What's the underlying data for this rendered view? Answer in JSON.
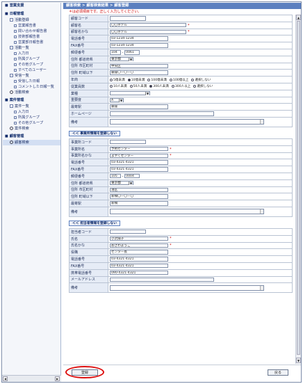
{
  "sidebar": {
    "sections": [
      {
        "title": "営業支援",
        "type": "sec"
      },
      {
        "title": "日報管理",
        "type": "sec"
      },
      {
        "title": "活動登録",
        "type": "sub"
      },
      {
        "title": "営業報告書",
        "type": "it"
      },
      {
        "title": "問い合わせ報告書",
        "type": "it"
      },
      {
        "title": "技術部報告書",
        "type": "it"
      },
      {
        "title": "営業部日報告書",
        "type": "it"
      },
      {
        "title": "活動一覧",
        "type": "sub"
      },
      {
        "title": "入力日",
        "type": "it"
      },
      {
        "title": "所属グループ",
        "type": "it"
      },
      {
        "title": "その他グループ",
        "type": "it"
      },
      {
        "title": "すべてのユーザー",
        "type": "it"
      },
      {
        "title": "受信一覧",
        "type": "sub"
      },
      {
        "title": "受信した日報",
        "type": "it"
      },
      {
        "title": "コメントした日報一覧",
        "type": "it"
      },
      {
        "title": "活動検索",
        "type": "search"
      },
      {
        "title": "案件管理",
        "type": "sec"
      },
      {
        "title": "案件一覧",
        "type": "sub"
      },
      {
        "title": "入力日",
        "type": "it"
      },
      {
        "title": "所属グループ",
        "type": "it"
      },
      {
        "title": "その他グループ",
        "type": "it"
      },
      {
        "title": "案件検索",
        "type": "search"
      },
      {
        "title": "顧客管理",
        "type": "sec"
      },
      {
        "title": "顧客検索",
        "type": "search-sel"
      }
    ]
  },
  "header": {
    "breadcrumb": "顧客検索 > 顧客検索結果 > 顧客登録",
    "note": "＊は必須項目です。正しく入力してください。"
  },
  "customer": {
    "code_label": "顧客コード",
    "code": "",
    "name_label": "顧客名",
    "name": "〇〇ホテル",
    "kana_label": "顧客名かな",
    "kana": "〇〇ホテル",
    "tel_label": "電話番号",
    "tel": "03-1234-1234",
    "fax_label": "FAX番号",
    "fax": "03-1234-1234",
    "zip_label": "郵便番号",
    "zip1": "104",
    "zip2": "0061",
    "pref_label": "住所 都道府県",
    "pref": "東京都",
    "city_label": "住所 市区町村",
    "city": "中央区",
    "street_label": "住所 町域以下",
    "street": "銀座〇－〇－〇",
    "years_label": "年商",
    "years_opts": [
      "5億未満",
      "10億未満",
      "100億未満",
      "100億以上",
      "選択しない"
    ],
    "years_selected": 1,
    "emp_label": "従業員数",
    "emp_opts": [
      "10人未満",
      "50人未満",
      "300人未満",
      "300人以上",
      "選択しない"
    ],
    "emp_selected": 2,
    "industry_label": "業種",
    "industry": "",
    "importance_label": "重要度",
    "importance": "A",
    "station_label": "最寄駅",
    "station": "銀座",
    "homepage_label": "ホームページ",
    "homepage": "",
    "memo_label": "備考"
  },
  "office_toggle": "＜＜ 事業所情報を登録しない",
  "office": {
    "code_label": "事業所コード",
    "code": "",
    "name_label": "事業所名",
    "name": "予約センター",
    "kana_label": "事業所名かな",
    "kana": "よやくセンター",
    "tel_label": "電話番号",
    "tel": "03-4321-4321",
    "fax_label": "FAX番号",
    "fax": "03-4321-4321",
    "zip_label": "郵便番号",
    "zip1": "105",
    "zip2": "0004",
    "pref_label": "住所 都道府県",
    "pref": "東京都",
    "city_label": "住所 市区町村",
    "city": "港区",
    "street_label": "住所 町域以下",
    "street": "新橋〇－〇－〇",
    "station_label": "最寄駅",
    "station": "新橋",
    "memo_label": "備考"
  },
  "person_toggle": "＜＜ 担当者情報を登録しない",
  "person": {
    "code_label": "担当者コード",
    "code": "",
    "name_label": "氏名",
    "name": "小沢陽子",
    "kana_label": "氏名かな",
    "kana": "おざわようこ",
    "position_label": "役職",
    "position": "センター長",
    "tel_label": "電話番号",
    "tel": "03-4321-4321",
    "fax_label": "FAX番号",
    "fax": "03-4321-4321",
    "mobile_label": "携帯電話番号",
    "mobile": "090-4321-4321",
    "mail_label": "メールアドレス",
    "mail": "",
    "memo_label": "備考"
  },
  "footer": {
    "register": "登録",
    "back": "戻る"
  },
  "colors": {
    "accent": "#5b7fbf",
    "required": "#cc0000",
    "highlight_circle": "#dd1111"
  }
}
